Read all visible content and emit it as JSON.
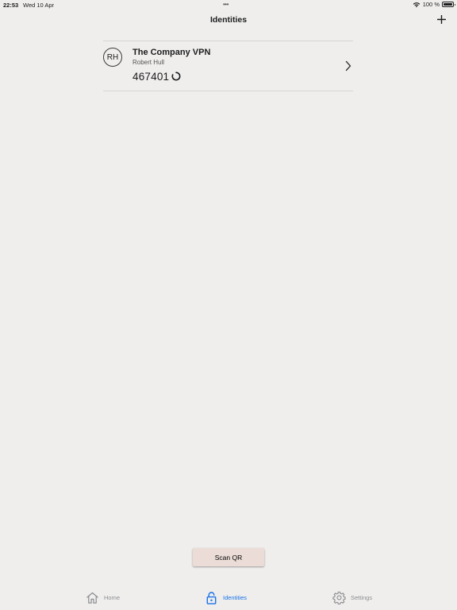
{
  "status_bar": {
    "time": "22:53",
    "date": "Wed 10 Apr",
    "battery": "100 %",
    "multitask_dots": "•••"
  },
  "nav": {
    "title": "Identities",
    "add_icon": "plus-icon"
  },
  "identities": [
    {
      "initials": "RH",
      "name": "The Company VPN",
      "user": "Robert Hull",
      "code": "467401",
      "timer_icon": "countdown-ring-icon",
      "chevron_icon": "chevron-right-icon"
    }
  ],
  "scan_button": {
    "label": "Scan QR",
    "color": "#ebdcd7"
  },
  "tabs": [
    {
      "label": "Home",
      "icon": "home-icon",
      "active": false
    },
    {
      "label": "Identities",
      "icon": "lock-icon",
      "active": true
    },
    {
      "label": "Settings",
      "icon": "gear-icon",
      "active": false
    }
  ],
  "colors": {
    "background": "#efeeec",
    "accent": "#1a73e8",
    "inactive_tab": "#8e8e93"
  }
}
